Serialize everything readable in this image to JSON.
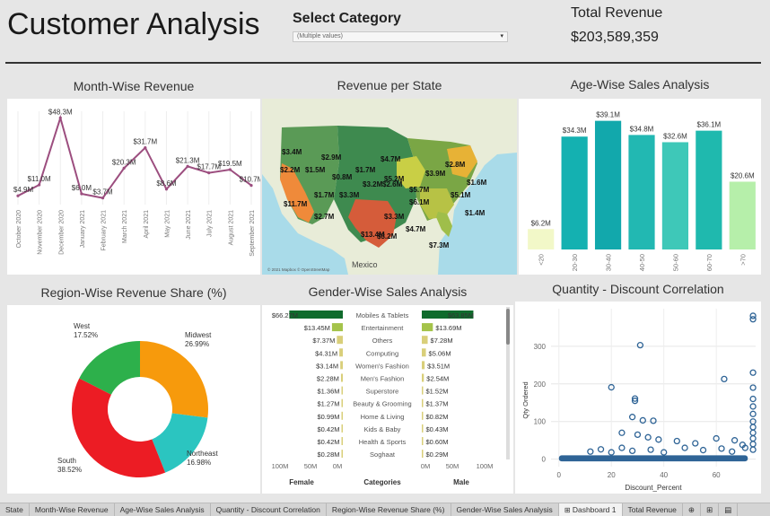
{
  "header": {
    "title": "Customer Analysis",
    "select_label": "Select Category",
    "select_value": "(Multiple values)",
    "revenue_label": "Total Revenue",
    "revenue_value": "$203,589,359"
  },
  "month_chart": {
    "title": "Month-Wise Revenue",
    "color": "#9c4e7f",
    "chart_data": {
      "type": "line",
      "x": [
        "October 2020",
        "November 2020",
        "December 2020",
        "January 2021",
        "February 2021",
        "March 2021",
        "April 2021",
        "May 2021",
        "June 2021",
        "July 2021",
        "August 2021",
        "September 2021"
      ],
      "values": [
        4.9,
        11.0,
        48.3,
        6.0,
        3.7,
        20.3,
        31.7,
        8.6,
        21.3,
        17.7,
        19.5,
        10.7
      ],
      "labels": [
        "$4.9M",
        "$11.0M",
        "$48.3M",
        "$6.0M",
        "$3.7M",
        "$20.3M",
        "$31.7M",
        "$8.6M",
        "$21.3M",
        "$17.7M",
        "$19.5M",
        "$10.7M"
      ],
      "ylim": [
        0,
        52
      ]
    }
  },
  "state_map": {
    "title": "Revenue per State",
    "attribution": "© 2021 Mapbox © OpenStreetMap",
    "country_label": "Mexico",
    "labels": [
      "$3.4M",
      "$2.9M",
      "$4.7M",
      "$2.2M",
      "$1.5M",
      "$1.7M",
      "$0.8M",
      "$2.6M",
      "$5.2M",
      "$3.9M",
      "$2.8M",
      "$5.7M",
      "$11.7M",
      "$1.7M",
      "$3.3M",
      "$3.2M",
      "$5.1M",
      "$6.1M",
      "$2.7M",
      "$3.3M",
      "$13.4M",
      "$3.2M",
      "$4.7M",
      "$7.3M",
      "$1.4M",
      "$1.6M"
    ]
  },
  "age_chart": {
    "title": "Age-Wise Sales Analysis",
    "chart_data": {
      "type": "bar",
      "categories": [
        "<20",
        "20-30",
        "30-40",
        "40-50",
        "50-60",
        "60-70",
        ">70"
      ],
      "values": [
        6.2,
        34.3,
        39.1,
        34.8,
        32.6,
        36.1,
        20.6
      ],
      "labels": [
        "$6.2M",
        "$34.3M",
        "$39.1M",
        "$34.8M",
        "$32.6M",
        "$36.1M",
        "$20.6M"
      ],
      "colors": [
        "#f2f8c8",
        "#14b1b1",
        "#12a8ac",
        "#22b8b2",
        "#3ec8b8",
        "#1fb9ae",
        "#b6efaa"
      ],
      "ylim": [
        0,
        42
      ]
    }
  },
  "region_chart": {
    "title": "Region-Wise Revenue Share (%)",
    "chart_data": {
      "type": "pie",
      "categories": [
        "West",
        "Midwest",
        "Northeast",
        "South"
      ],
      "values": [
        17.52,
        26.99,
        16.98,
        38.52
      ],
      "label_values": [
        "17.52%",
        "26.99%",
        "16.98%",
        "38.52%"
      ],
      "colors": [
        "#2db04b",
        "#f79a0c",
        "#2bc5c0",
        "#ec1c24"
      ]
    }
  },
  "gender_chart": {
    "title": "Gender-Wise Sales Analysis",
    "female_label": "Female",
    "category_label": "Categories",
    "male_label": "Male",
    "axis_ticks": [
      "100M",
      "50M",
      "0M"
    ],
    "chart_data": {
      "type": "bar",
      "categories": [
        "Mobiles & Tablets",
        "Entertainment",
        "Others",
        "Computing",
        "Women's Fashion",
        "Men's Fashion",
        "Superstore",
        "Beauty & Grooming",
        "Home & Living",
        "Kids & Baby",
        "Health & Sports",
        "Soghaat"
      ],
      "series": [
        {
          "name": "Female",
          "values": [
            66.27,
            13.45,
            7.37,
            4.31,
            3.14,
            2.28,
            1.36,
            1.27,
            0.99,
            0.42,
            0.42,
            0.28
          ],
          "labels": [
            "$66.27M",
            "$13.45M",
            "$7.37M",
            "$4.31M",
            "$3.14M",
            "$2.28M",
            "$1.36M",
            "$1.27M",
            "$0.99M",
            "$0.42M",
            "$0.42M",
            "$0.28M"
          ]
        },
        {
          "name": "Male",
          "values": [
            63.85,
            13.69,
            7.28,
            5.06,
            3.51,
            2.54,
            1.52,
            1.37,
            0.82,
            0.43,
            0.6,
            0.29
          ],
          "labels": [
            "$63.85M",
            "$13.69M",
            "$7.28M",
            "$5.06M",
            "$3.51M",
            "$2.54M",
            "$1.52M",
            "$1.37M",
            "$0.82M",
            "$0.43M",
            "$0.60M",
            "$0.29M"
          ]
        }
      ],
      "xlim": [
        0,
        100
      ]
    }
  },
  "qd_chart": {
    "title": "Quantity - Discount Correlation",
    "color": "#2f6496",
    "chart_data": {
      "type": "scatter",
      "xlabel": "Discount_Percent",
      "ylabel": "Qty Ordered",
      "xlim": [
        -3,
        75
      ],
      "ylim": [
        -20,
        400
      ],
      "xticks": [
        0,
        20,
        40,
        60
      ],
      "yticks": [
        0,
        100,
        200,
        300
      ],
      "points": [
        [
          31,
          303
        ],
        [
          20,
          191
        ],
        [
          63,
          213
        ],
        [
          74,
          381
        ],
        [
          74,
          372
        ],
        [
          29,
          161
        ],
        [
          29,
          155
        ],
        [
          28,
          112
        ],
        [
          32,
          103
        ],
        [
          36,
          102
        ],
        [
          24,
          70
        ],
        [
          30,
          65
        ],
        [
          34,
          58
        ],
        [
          38,
          52
        ],
        [
          45,
          48
        ],
        [
          52,
          42
        ],
        [
          60,
          55
        ],
        [
          67,
          50
        ],
        [
          70,
          38
        ],
        [
          74,
          230
        ],
        [
          74,
          190
        ],
        [
          74,
          160
        ],
        [
          74,
          140
        ],
        [
          74,
          120
        ],
        [
          74,
          100
        ],
        [
          74,
          85
        ],
        [
          74,
          70
        ],
        [
          74,
          55
        ],
        [
          74,
          40
        ],
        [
          74,
          25
        ],
        [
          12,
          20
        ],
        [
          16,
          26
        ],
        [
          20,
          18
        ],
        [
          24,
          30
        ],
        [
          28,
          22
        ],
        [
          35,
          25
        ],
        [
          40,
          18
        ],
        [
          48,
          30
        ],
        [
          55,
          24
        ],
        [
          62,
          28
        ],
        [
          66,
          20
        ],
        [
          71,
          30
        ]
      ]
    }
  },
  "tabs": [
    "State",
    "Month-Wise Revenue",
    "Age-Wise Sales Analysis",
    "Quantity - Discount Correlation",
    "Region-Wise Revenue Share (%)",
    "Gender-Wise Sales Analysis",
    "Dashboard 1",
    "Total Revenue"
  ],
  "active_tab": "Dashboard 1"
}
